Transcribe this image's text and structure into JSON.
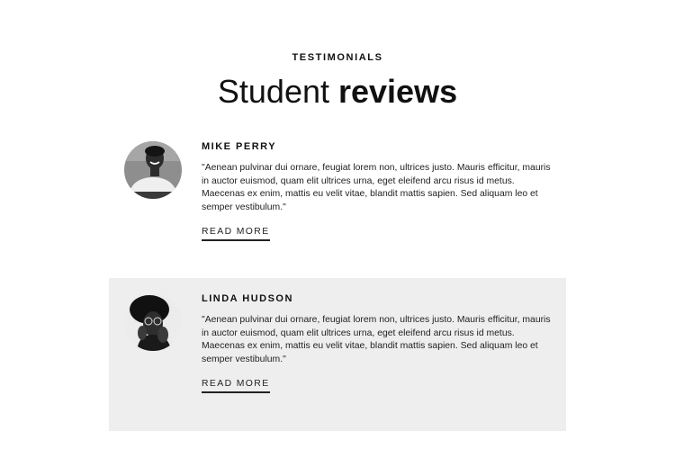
{
  "section": {
    "eyebrow": "TESTIMONIALS",
    "title_light": "Student ",
    "title_bold": "reviews"
  },
  "reviews": [
    {
      "name": "MIKE PERRY",
      "quote": "\"Aenean pulvinar dui ornare, feugiat lorem non, ultrices justo. Mauris efficitur, mauris in auctor euismod, quam elit ultrices urna, eget eleifend arcu risus id metus. Maecenas ex enim, mattis eu velit vitae, blandit mattis sapien. Sed aliquam leo et semper vestibulum.\"",
      "link_label": "READ MORE",
      "avatar_icon": "person-photo-icon"
    },
    {
      "name": "LINDA HUDSON",
      "quote": "\"Aenean pulvinar dui ornare, feugiat lorem non, ultrices justo. Mauris efficitur, mauris in auctor euismod, quam elit ultrices urna, eget eleifend arcu risus id metus. Maecenas ex enim, mattis eu velit vitae, blandit mattis sapien. Sed aliquam leo et semper vestibulum.\"",
      "link_label": "READ MORE",
      "avatar_icon": "person-photo-icon"
    }
  ],
  "colors": {
    "text": "#111111",
    "highlight_card": "#eeeeee",
    "background": "#ffffff"
  }
}
